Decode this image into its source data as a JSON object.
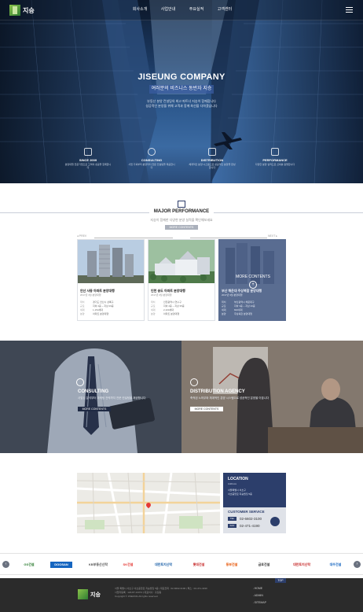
{
  "header": {
    "logo_text": "지승",
    "nav": [
      "회사소개",
      "사업안내",
      "주요실적",
      "고객센터"
    ]
  },
  "hero": {
    "title": "JISEUNG COMPANY",
    "subtitle": "여러분의 비즈니스 동반자 지승",
    "desc_line1": "부동산 분양 컨설팅의 최고 파트너 지승이 함께합니다",
    "desc_line2": "성공적인 분양을 위해 고객과 함께 최선을 다하겠습니다"
  },
  "features": [
    {
      "title": "SINCE 2009",
      "desc": "분양대행 전문기업으로 고객의 성공을 함께합니다",
      "icon": "box-icon"
    },
    {
      "title": "CONSULTING",
      "desc": "사업 기획부터 분양까지 전문 컨설팅을 제공합니다",
      "icon": "lightbulb-icon"
    },
    {
      "title": "DISTRIBUTION",
      "desc": "체계적인 분양 시스템으로 성공적인 분양을 완성합니다",
      "icon": "chart-icon"
    },
    {
      "title": "PERFORMANCE",
      "desc": "다양한 분양 실적으로 신뢰를 증명합니다",
      "icon": "badge-icon"
    }
  ],
  "major": {
    "title": "MAJOR PERFORMANCE",
    "desc": "지승이 함께한 다양한 분양 실적을 확인해보세요",
    "button": "MORE CONTENTS",
    "prev": "PREV",
    "next": "NEXT",
    "cards": [
      {
        "name": "안산 사동 아파트 분양대행",
        "date": "2017년 3월 분양대행",
        "rows": [
          [
            "위치",
            "경기도 안산시 상록구"
          ],
          [
            "규모",
            "지하 2층 ~ 지상 29층"
          ],
          [
            "세대",
            "1,153세대"
          ],
          [
            "분양",
            "아파트 분양대행"
          ]
        ]
      },
      {
        "name": "인천 송도 아파트 분양대행",
        "date": "2017년 6월 분양대행",
        "rows": [
          [
            "위치",
            "인천광역시 연수구"
          ],
          [
            "규모",
            "지하 2층 ~ 지상 35층"
          ],
          [
            "세대",
            "2,100세대"
          ],
          [
            "분양",
            "아파트 분양대행"
          ]
        ]
      },
      {
        "name": "부산 해운대 주상복합 분양대행",
        "date": "2017년 9월 분양대행",
        "rows": [
          [
            "위치",
            "부산광역시 해운대구"
          ],
          [
            "규모",
            "지하 3층 ~ 지상 40층"
          ],
          [
            "세대",
            "820세대"
          ],
          [
            "분양",
            "주상복합 분양대행"
          ]
        ],
        "more": "MORE CONTENTS"
      }
    ]
  },
  "consulting": {
    "title": "CONSULTING",
    "desc": "사업성 분석부터 마케팅 전략까지 전문 컨설팅을 제공합니다",
    "button": "MORE CONTENTS"
  },
  "distribution": {
    "title": "DISTRIBUTION AGENCY",
    "desc": "축적된 노하우와 체계적인 분양 시스템으로 성공적인 분양을 이끕니다",
    "button": "MORE CONTENTS"
  },
  "location": {
    "title": "LOCATION",
    "sub": "Address",
    "addr1": "서울특별시 서초구",
    "addr2": "서초중앙로 지승빌딩 5층"
  },
  "customer": {
    "title": "CUSTOMER SERVICE",
    "tel_label": "TEL",
    "tel": "02-6602-3100",
    "fax_label": "FAX",
    "fax": "02-471-4190"
  },
  "partners": [
    "GS건설",
    "DOOSAN",
    "KB부동산신탁",
    "SK건설",
    "대한토지신탁",
    "롯데건설",
    "동부건설",
    "금호건설",
    "대한토지신탁",
    "대우건설"
  ],
  "footer": {
    "logo_text": "지승",
    "info1": "서울 특별시 서초구 서초중앙로 지승빌딩 5층 | 대표전화 : 02-6602-3100 | 팩스 : 02-471-4190",
    "info2": "사업자등록 : 120-87-13374 | 대표이사 : 홍길동",
    "copyright": "Copyright © JISEUNG All rights reserved.",
    "links": [
      "HOME",
      "ADMIN",
      "SITEMAP"
    ],
    "top": "TOP"
  }
}
